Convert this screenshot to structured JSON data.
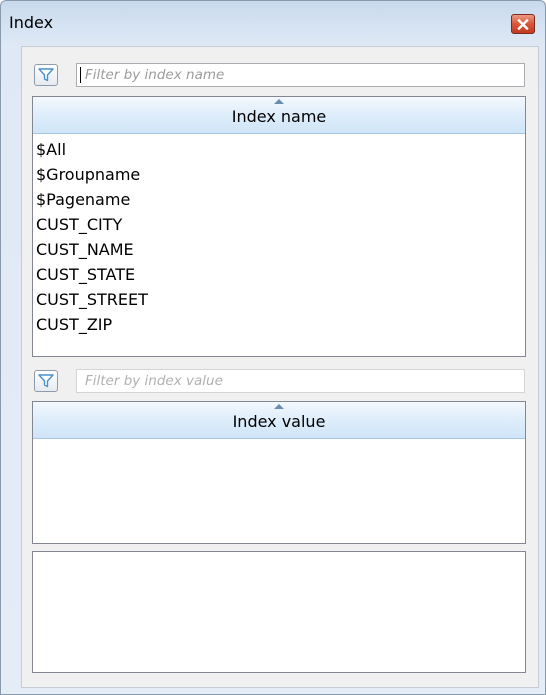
{
  "window": {
    "title": "Index"
  },
  "name_filter": {
    "placeholder": "Filter by index name",
    "value": ""
  },
  "name_list": {
    "header": "Index name",
    "items": [
      "$All",
      "$Groupname",
      "$Pagename",
      "CUST_CITY",
      "CUST_NAME",
      "CUST_STATE",
      "CUST_STREET",
      "CUST_ZIP"
    ]
  },
  "value_filter": {
    "placeholder": "Filter by index value",
    "value": ""
  },
  "value_list": {
    "header": "Index value",
    "items": []
  },
  "detail_panel": {
    "text": ""
  },
  "icons": {
    "filter": "funnel-icon",
    "close": "close-icon",
    "sort": "sort-ascending-icon"
  },
  "colors": {
    "close_button": "#d8553b",
    "header_blue": "#cfe5f8",
    "filter_icon": "#4a8fd0"
  }
}
